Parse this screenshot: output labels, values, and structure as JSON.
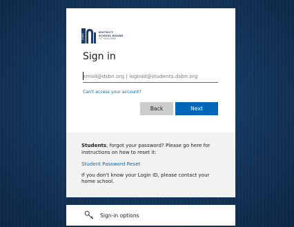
{
  "logo": {
    "badge": "DSBN",
    "line1": "DISTRICT",
    "line2": "SCHOOL BOARD",
    "line3": "OF NIAGARA"
  },
  "signin": {
    "title": "Sign in",
    "email_placeholder": "email@dsbn.org | loginid@students.dsbn.org",
    "email_value": "",
    "cant_access_label": "Can't access your account?",
    "back_label": "Back",
    "next_label": "Next"
  },
  "info": {
    "students_bold": "Students",
    "students_text": ", forgot your password? Please go here for instructions on how to reset it:",
    "reset_link_label": "Student Password Reset",
    "contact_text": "If you don't know your Login ID, please contact your home school."
  },
  "options": {
    "label": "Sign-in options",
    "icon": "key-icon"
  },
  "colors": {
    "accent": "#0067b8",
    "background": "#153960"
  }
}
